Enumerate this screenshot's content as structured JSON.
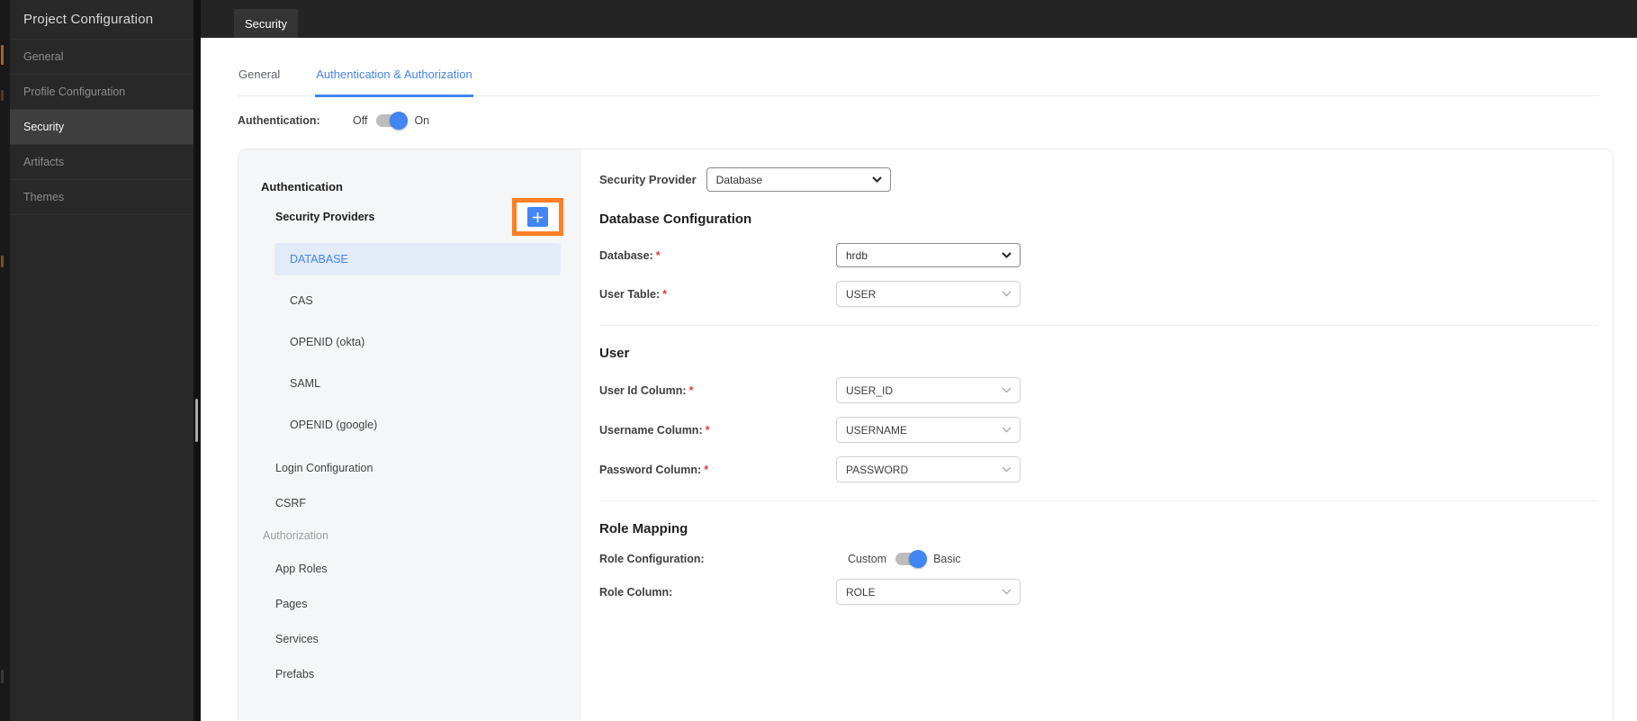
{
  "colors": {
    "accent_blue": "#4285f4",
    "highlight_orange": "#ff7f27",
    "required_red": "#e53935",
    "selected_provider_bg": "#e3eaf8"
  },
  "sidebar": {
    "title": "Project Configuration",
    "items": [
      {
        "label": "General"
      },
      {
        "label": "Profile Configuration"
      },
      {
        "label": "Security"
      },
      {
        "label": "Artifacts"
      },
      {
        "label": "Themes"
      }
    ]
  },
  "topbar": {
    "tab_label": "Security"
  },
  "content": {
    "tabs": [
      {
        "label": "General"
      },
      {
        "label": "Authentication & Authorization"
      }
    ],
    "auth_row": {
      "label": "Authentication:",
      "off_label": "Off",
      "on_label": "On",
      "state": "on"
    }
  },
  "nav": {
    "section_authentication": "Authentication",
    "security_providers_label": "Security Providers",
    "providers": [
      "DATABASE",
      "CAS",
      "OPENID (okta)",
      "SAML",
      "OPENID (google)"
    ],
    "selected_provider": "DATABASE",
    "login_configuration": "Login Configuration",
    "csrf": "CSRF",
    "section_authorization": "Authorization",
    "authorization_items": [
      "App Roles",
      "Pages",
      "Services",
      "Prefabs"
    ]
  },
  "form": {
    "required_marker": "*",
    "provider": {
      "label": "Security Provider",
      "value": "Database"
    },
    "database_section": {
      "title": "Database Configuration",
      "database_label": "Database:",
      "database_value": "hrdb",
      "user_table_label": "User Table:",
      "user_table_value": "USER"
    },
    "user_section": {
      "title": "User",
      "user_id_label": "User Id Column:",
      "user_id_value": "USER_ID",
      "username_label": "Username Column:",
      "username_value": "USERNAME",
      "password_label": "Password Column:",
      "password_value": "PASSWORD"
    },
    "role_section": {
      "title": "Role Mapping",
      "role_config_label": "Role Configuration:",
      "custom_label": "Custom",
      "basic_label": "Basic",
      "state": "basic",
      "role_column_label": "Role Column:",
      "role_column_value": "ROLE"
    }
  }
}
